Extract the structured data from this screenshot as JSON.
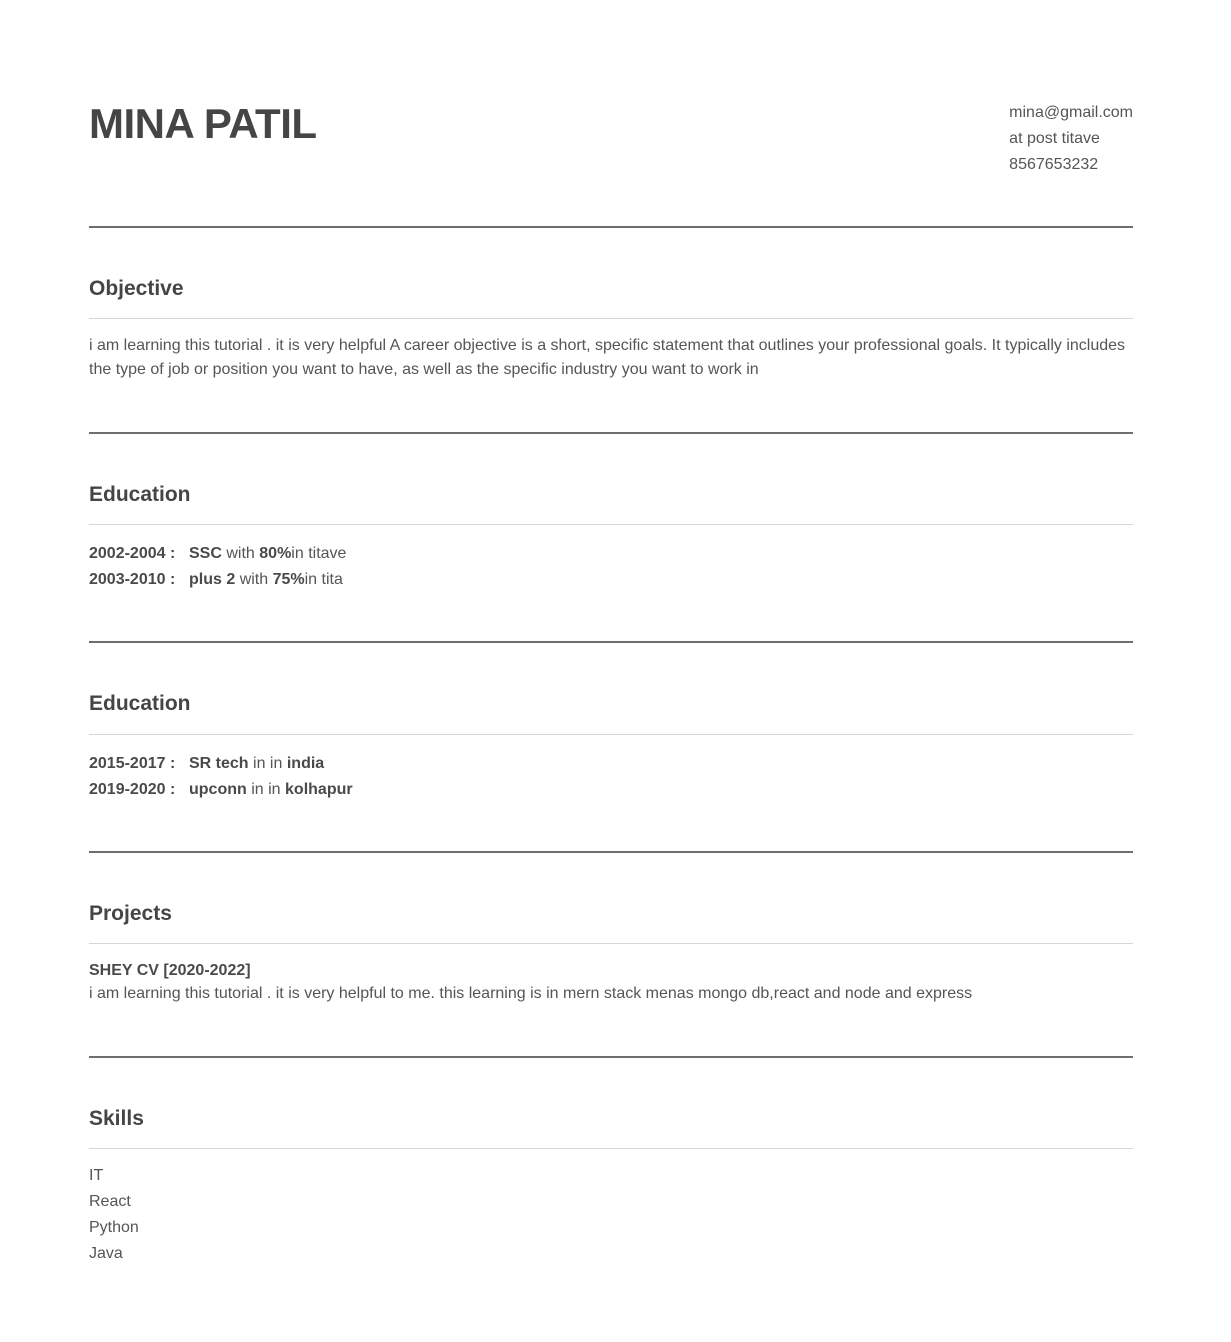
{
  "header": {
    "name": "MINA PATIL",
    "email": "mina@gmail.com",
    "address": "at post titave",
    "phone": "8567653232"
  },
  "objective": {
    "title": "Objective",
    "text": "i am learning this tutorial . it is very helpful A career objective is a short, specific statement that outlines your professional goals. It typically includes the type of job or position you want to have, as well as the specific industry you want to work in"
  },
  "education": {
    "title": "Education",
    "items": [
      {
        "years": "2002-2004 :",
        "course": "SSC",
        "with": "with",
        "pct": "80%",
        "place": "in titave"
      },
      {
        "years": "2003-2010 :",
        "course": "plus 2",
        "with": "with",
        "pct": "75%",
        "place": "in tita"
      }
    ]
  },
  "experience": {
    "title": "Education",
    "items": [
      {
        "years": "2015-2017 :",
        "company": "SR tech",
        "in": "in in",
        "place": "india"
      },
      {
        "years": "2019-2020 :",
        "company": "upconn",
        "in": "in in",
        "place": "kolhapur"
      }
    ]
  },
  "projects": {
    "title": "Projects",
    "items": [
      {
        "name": "SHEY CV [2020-2022]",
        "desc": "i am learning this tutorial . it is very helpful to me. this learning is in mern stack menas mongo db,react and node and express"
      }
    ]
  },
  "skills": {
    "title": "Skills",
    "items": [
      "IT",
      "React",
      "Python",
      "Java"
    ]
  }
}
